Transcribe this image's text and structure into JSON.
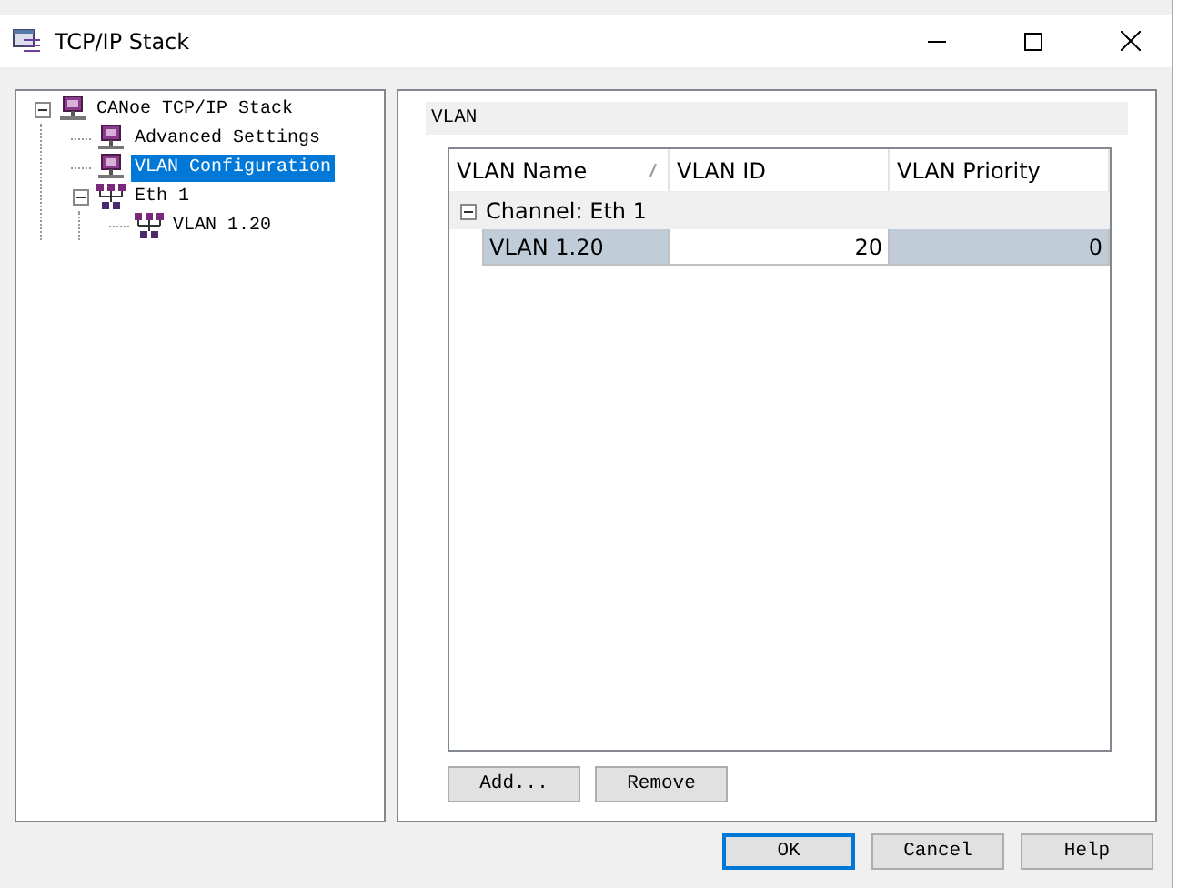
{
  "window": {
    "title": "TCP/IP Stack"
  },
  "tree": [
    {
      "label": "CANoe TCP/IP Stack",
      "kind": "node",
      "selected": false,
      "expanded": true,
      "children": [
        {
          "label": "Advanced Settings",
          "kind": "node",
          "selected": false
        },
        {
          "label": "VLAN Configuration",
          "kind": "node",
          "selected": true
        },
        {
          "label": "Eth 1",
          "kind": "network",
          "selected": false,
          "expanded": true,
          "children": [
            {
              "label": "VLAN 1.20",
              "kind": "network",
              "selected": false
            }
          ]
        }
      ]
    }
  ],
  "panel": {
    "title": "VLAN"
  },
  "grid": {
    "columns": [
      "VLAN Name",
      "VLAN ID",
      "VLAN Priority"
    ],
    "groups": [
      {
        "label": "Channel: Eth 1",
        "expanded": true,
        "rows": [
          {
            "cells": [
              "VLAN 1.20",
              "20",
              "0"
            ],
            "selected": true
          }
        ]
      }
    ]
  },
  "panel_buttons": [
    "Add...",
    "Remove"
  ],
  "dialog_buttons": [
    {
      "label": "OK",
      "default": true
    },
    {
      "label": "Cancel",
      "default": false
    },
    {
      "label": "Help",
      "default": false
    }
  ]
}
